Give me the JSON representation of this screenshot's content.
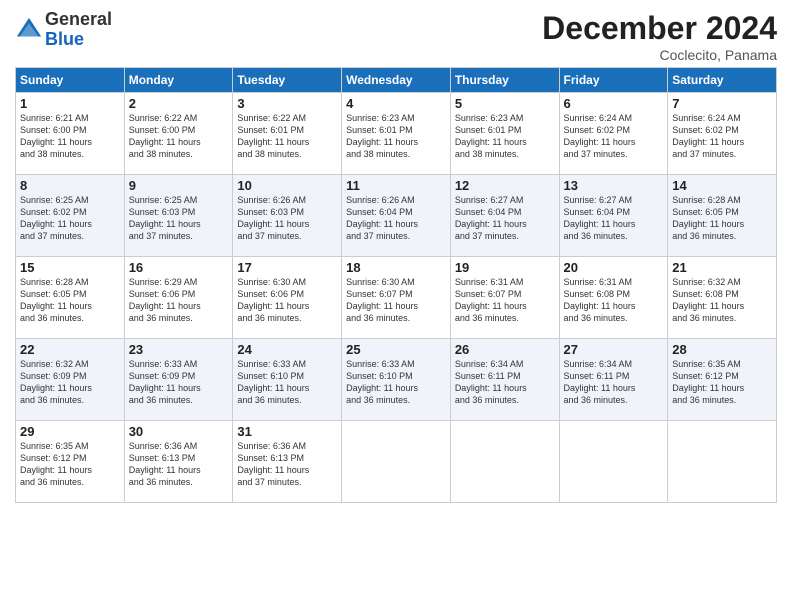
{
  "header": {
    "logo_line1": "General",
    "logo_line2": "Blue",
    "title": "December 2024",
    "location": "Coclecito, Panama"
  },
  "days_of_week": [
    "Sunday",
    "Monday",
    "Tuesday",
    "Wednesday",
    "Thursday",
    "Friday",
    "Saturday"
  ],
  "weeks": [
    [
      {
        "day": "1",
        "text": "Sunrise: 6:21 AM\nSunset: 6:00 PM\nDaylight: 11 hours\nand 38 minutes."
      },
      {
        "day": "2",
        "text": "Sunrise: 6:22 AM\nSunset: 6:00 PM\nDaylight: 11 hours\nand 38 minutes."
      },
      {
        "day": "3",
        "text": "Sunrise: 6:22 AM\nSunset: 6:01 PM\nDaylight: 11 hours\nand 38 minutes."
      },
      {
        "day": "4",
        "text": "Sunrise: 6:23 AM\nSunset: 6:01 PM\nDaylight: 11 hours\nand 38 minutes."
      },
      {
        "day": "5",
        "text": "Sunrise: 6:23 AM\nSunset: 6:01 PM\nDaylight: 11 hours\nand 38 minutes."
      },
      {
        "day": "6",
        "text": "Sunrise: 6:24 AM\nSunset: 6:02 PM\nDaylight: 11 hours\nand 37 minutes."
      },
      {
        "day": "7",
        "text": "Sunrise: 6:24 AM\nSunset: 6:02 PM\nDaylight: 11 hours\nand 37 minutes."
      }
    ],
    [
      {
        "day": "8",
        "text": "Sunrise: 6:25 AM\nSunset: 6:02 PM\nDaylight: 11 hours\nand 37 minutes."
      },
      {
        "day": "9",
        "text": "Sunrise: 6:25 AM\nSunset: 6:03 PM\nDaylight: 11 hours\nand 37 minutes."
      },
      {
        "day": "10",
        "text": "Sunrise: 6:26 AM\nSunset: 6:03 PM\nDaylight: 11 hours\nand 37 minutes."
      },
      {
        "day": "11",
        "text": "Sunrise: 6:26 AM\nSunset: 6:04 PM\nDaylight: 11 hours\nand 37 minutes."
      },
      {
        "day": "12",
        "text": "Sunrise: 6:27 AM\nSunset: 6:04 PM\nDaylight: 11 hours\nand 37 minutes."
      },
      {
        "day": "13",
        "text": "Sunrise: 6:27 AM\nSunset: 6:04 PM\nDaylight: 11 hours\nand 36 minutes."
      },
      {
        "day": "14",
        "text": "Sunrise: 6:28 AM\nSunset: 6:05 PM\nDaylight: 11 hours\nand 36 minutes."
      }
    ],
    [
      {
        "day": "15",
        "text": "Sunrise: 6:28 AM\nSunset: 6:05 PM\nDaylight: 11 hours\nand 36 minutes."
      },
      {
        "day": "16",
        "text": "Sunrise: 6:29 AM\nSunset: 6:06 PM\nDaylight: 11 hours\nand 36 minutes."
      },
      {
        "day": "17",
        "text": "Sunrise: 6:30 AM\nSunset: 6:06 PM\nDaylight: 11 hours\nand 36 minutes."
      },
      {
        "day": "18",
        "text": "Sunrise: 6:30 AM\nSunset: 6:07 PM\nDaylight: 11 hours\nand 36 minutes."
      },
      {
        "day": "19",
        "text": "Sunrise: 6:31 AM\nSunset: 6:07 PM\nDaylight: 11 hours\nand 36 minutes."
      },
      {
        "day": "20",
        "text": "Sunrise: 6:31 AM\nSunset: 6:08 PM\nDaylight: 11 hours\nand 36 minutes."
      },
      {
        "day": "21",
        "text": "Sunrise: 6:32 AM\nSunset: 6:08 PM\nDaylight: 11 hours\nand 36 minutes."
      }
    ],
    [
      {
        "day": "22",
        "text": "Sunrise: 6:32 AM\nSunset: 6:09 PM\nDaylight: 11 hours\nand 36 minutes."
      },
      {
        "day": "23",
        "text": "Sunrise: 6:33 AM\nSunset: 6:09 PM\nDaylight: 11 hours\nand 36 minutes."
      },
      {
        "day": "24",
        "text": "Sunrise: 6:33 AM\nSunset: 6:10 PM\nDaylight: 11 hours\nand 36 minutes."
      },
      {
        "day": "25",
        "text": "Sunrise: 6:33 AM\nSunset: 6:10 PM\nDaylight: 11 hours\nand 36 minutes."
      },
      {
        "day": "26",
        "text": "Sunrise: 6:34 AM\nSunset: 6:11 PM\nDaylight: 11 hours\nand 36 minutes."
      },
      {
        "day": "27",
        "text": "Sunrise: 6:34 AM\nSunset: 6:11 PM\nDaylight: 11 hours\nand 36 minutes."
      },
      {
        "day": "28",
        "text": "Sunrise: 6:35 AM\nSunset: 6:12 PM\nDaylight: 11 hours\nand 36 minutes."
      }
    ],
    [
      {
        "day": "29",
        "text": "Sunrise: 6:35 AM\nSunset: 6:12 PM\nDaylight: 11 hours\nand 36 minutes."
      },
      {
        "day": "30",
        "text": "Sunrise: 6:36 AM\nSunset: 6:13 PM\nDaylight: 11 hours\nand 36 minutes."
      },
      {
        "day": "31",
        "text": "Sunrise: 6:36 AM\nSunset: 6:13 PM\nDaylight: 11 hours\nand 37 minutes."
      },
      {
        "day": "",
        "text": ""
      },
      {
        "day": "",
        "text": ""
      },
      {
        "day": "",
        "text": ""
      },
      {
        "day": "",
        "text": ""
      }
    ]
  ]
}
